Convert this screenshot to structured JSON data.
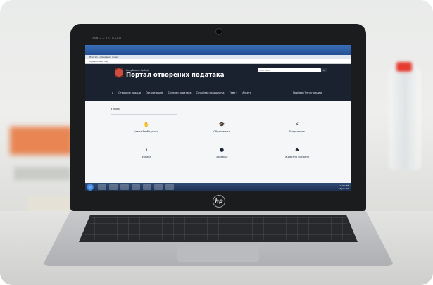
{
  "laptop": {
    "bezel_brand": "BANG & OLUFSEN",
    "logo": "hp"
  },
  "browser": {
    "tab_title": "Портал - отворених подат",
    "address_text": "Предложени Сајт"
  },
  "portal": {
    "republic": "Република Србија",
    "title": "Портал отворених података",
    "search_placeholder": "Претрага",
    "nav": [
      "Отворени подаци",
      "Организације",
      "Скупови података",
      "Случајеви коришћења",
      "Теме ▾",
      "Анкета"
    ],
    "login": "Пријава / Регистрација",
    "section_title": "Теме",
    "topics": [
      {
        "label": "Јавна безбедност",
        "icon": "hand-icon"
      },
      {
        "label": "Образовање",
        "icon": "graduation-cap-icon"
      },
      {
        "label": "Енергетика",
        "icon": "lightning-icon"
      },
      {
        "label": "Управа",
        "icon": "info-icon"
      },
      {
        "label": "Здравље",
        "icon": "apple-icon"
      },
      {
        "label": "Животна средина",
        "icon": "plant-icon"
      }
    ]
  },
  "taskbar": {
    "time": "12:30 PM",
    "date": "27-Jan-20"
  }
}
